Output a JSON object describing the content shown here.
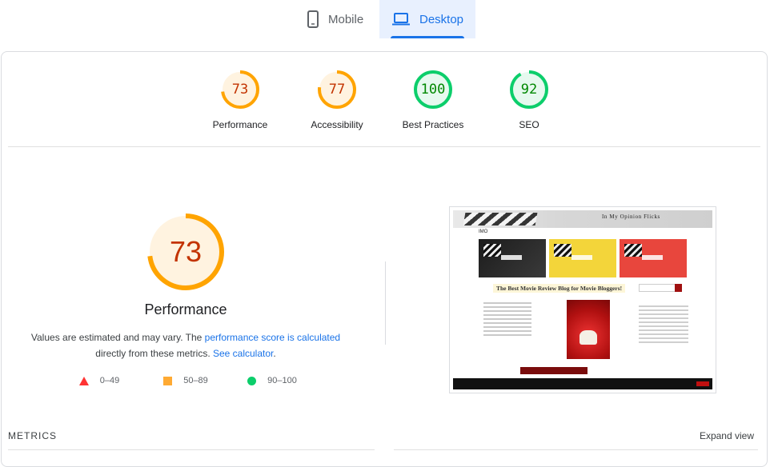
{
  "tabs": {
    "mobile_label": "Mobile",
    "desktop_label": "Desktop",
    "active": "Desktop"
  },
  "categories": [
    {
      "label": "Performance",
      "score": "73",
      "rating": "average"
    },
    {
      "label": "Accessibility",
      "score": "77",
      "rating": "average"
    },
    {
      "label": "Best Practices",
      "score": "100",
      "rating": "pass"
    },
    {
      "label": "SEO",
      "score": "92",
      "rating": "pass"
    }
  ],
  "performance": {
    "score": "73",
    "title": "Performance",
    "desc_prefix": "Values are estimated and may vary. The ",
    "desc_link1": "performance score is calculated",
    "desc_mid": " directly from these metrics. ",
    "desc_link2": "See calculator",
    "desc_suffix": "."
  },
  "legend": [
    {
      "range": "0–49",
      "shape": "triangle",
      "color": "#ff3333"
    },
    {
      "range": "50–89",
      "shape": "square",
      "color": "#ffaa33"
    },
    {
      "range": "90–100",
      "shape": "circle",
      "color": "#0cce6b"
    }
  ],
  "thumbnail": {
    "site_title": "In My Opinion Flicks",
    "headline": "The Best Movie Review Blog for Movie Bloggers!",
    "logo": "IMO"
  },
  "metrics": {
    "heading": "METRICS",
    "expand_label": "Expand view"
  },
  "colors": {
    "accent": "#1a73e8",
    "average": "#ffa400",
    "average_text": "#c33300",
    "pass": "#0cce6b",
    "pass_text": "#008800"
  }
}
